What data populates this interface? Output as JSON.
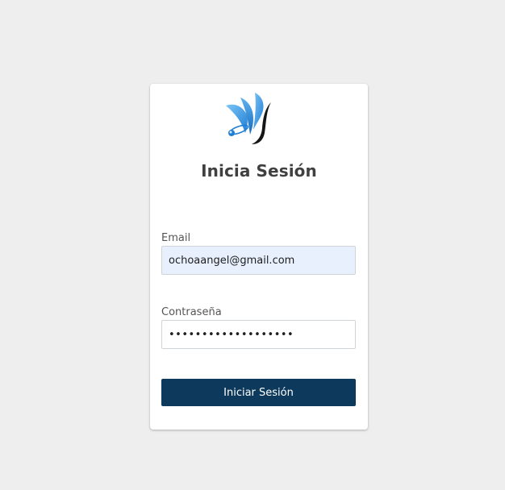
{
  "login": {
    "title": "Inicia Sesión",
    "logo_icon": "stylized-v-logo-icon",
    "email_label": "Email",
    "email_value": "ochoaangel@gmail.com",
    "password_label": "Contraseña",
    "password_value": "•••••••••••••••••••",
    "submit_label": "Iniciar Sesión"
  },
  "colors": {
    "page_background": "#eeeeee",
    "card_background": "#ffffff",
    "button_background": "#0d3a5c",
    "button_text": "#ffffff",
    "email_autofill_background": "#e8f0fe",
    "logo_blue": "#2a8fe0"
  }
}
